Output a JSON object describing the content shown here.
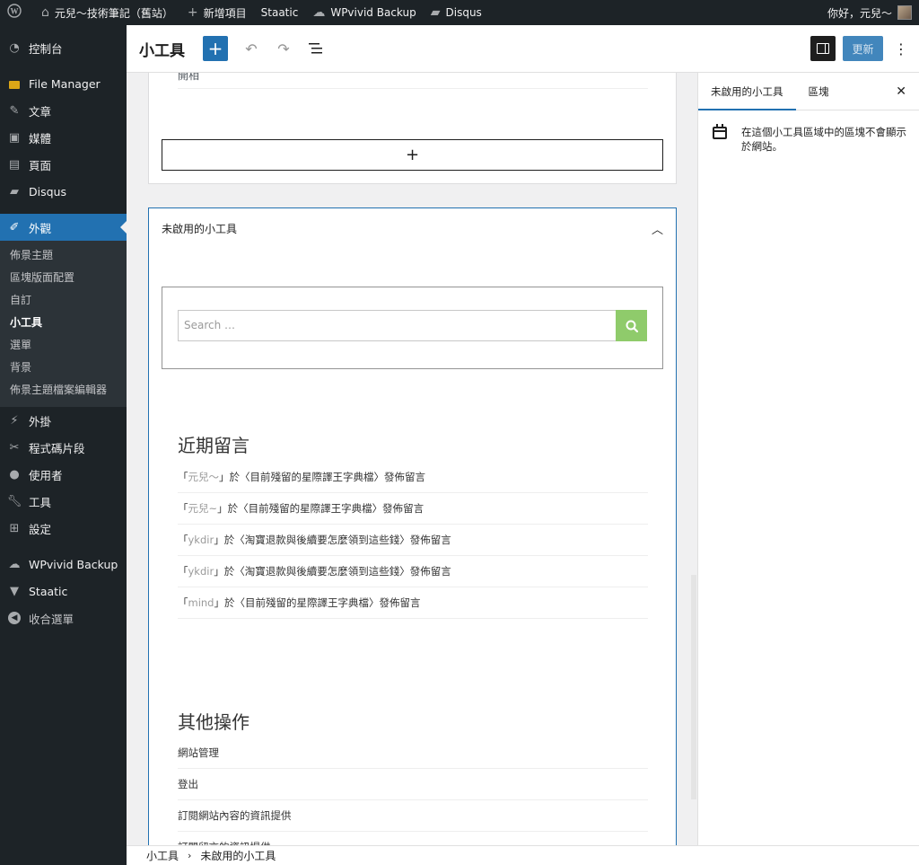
{
  "adminbar": {
    "wp_logo": "wordpress-logo",
    "site_name": "元兒～技術筆記（舊站）",
    "new_item": "新增項目",
    "staatic": "Staatic",
    "wpvivid": "WPvivid Backup",
    "disqus": "Disqus",
    "greeting": "你好，元兒～"
  },
  "sidebar": {
    "items": [
      {
        "label": "控制台",
        "icon": "dashboard-icon"
      },
      {
        "label": "File Manager",
        "icon": "folder-icon"
      },
      {
        "label": "文章",
        "icon": "pin-icon"
      },
      {
        "label": "媒體",
        "icon": "media-icon"
      },
      {
        "label": "頁面",
        "icon": "page-icon"
      },
      {
        "label": "Disqus",
        "icon": "comment-icon"
      },
      {
        "label": "外觀",
        "icon": "brush-icon"
      },
      {
        "label": "外掛",
        "icon": "plugin-icon"
      },
      {
        "label": "程式碼片段",
        "icon": "scissors-icon"
      },
      {
        "label": "使用者",
        "icon": "user-icon"
      },
      {
        "label": "工具",
        "icon": "wrench-icon"
      },
      {
        "label": "設定",
        "icon": "settings-icon"
      },
      {
        "label": "WPvivid Backup",
        "icon": "cloud-icon"
      },
      {
        "label": "Staatic",
        "icon": "staatic-icon"
      },
      {
        "label": "收合選單",
        "icon": "collapse-icon"
      }
    ],
    "submenu": [
      "佈景主題",
      "區塊版面配置",
      "自訂",
      "小工具",
      "選單",
      "背景",
      "佈景主題檔案編輯器"
    ]
  },
  "header": {
    "title": "小工具",
    "update_label": "更新"
  },
  "content": {
    "kaiguan_text": "開相",
    "add_block_symbol": "+",
    "inactive_panel_title": "未啟用的小工具",
    "search_placeholder": "Search …",
    "recent_comments_title": "近期留言",
    "comments": [
      {
        "author": "元兒～",
        "post": "目前殘留的星際譯王字典檔"
      },
      {
        "author": "元兒~",
        "post": "目前殘留的星際譯王字典檔"
      },
      {
        "author": "ykdir",
        "post": "淘寶退款與後續要怎麼領到這些錢"
      },
      {
        "author": "ykdir",
        "post": "淘寶退款與後續要怎麼領到這些錢"
      },
      {
        "author": "mind",
        "post": "目前殘留的星際譯王字典檔"
      }
    ],
    "comment_on": "於",
    "comment_suffix": "發佈留言",
    "other_actions_title": "其他操作",
    "other_actions": [
      "網站管理",
      "登出",
      "訂閱網站內容的資訊提供",
      "訂閱留言的資訊提供"
    ]
  },
  "settings": {
    "tab_active": "未啟用的小工具",
    "tab_area": "區塊",
    "description": "在這個小工具區域中的區塊不會顯示於網站。"
  },
  "footer": {
    "crumb_1": "小工具",
    "crumb_2": "未啟用的小工具"
  },
  "colors": {
    "admin_bg": "#1d2327",
    "accent": "#2271b1",
    "search_button": "#8fcb6b"
  }
}
